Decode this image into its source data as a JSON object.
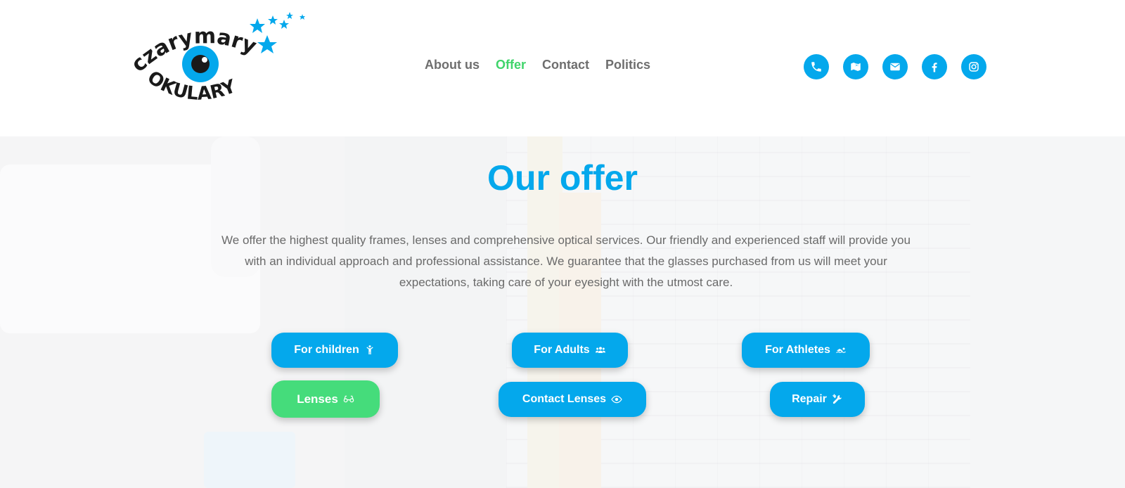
{
  "header": {
    "logo": {
      "text_top": "czarymary",
      "text_bottom": "OKULARY"
    },
    "nav": [
      {
        "label": "About us",
        "active": false
      },
      {
        "label": "Offer",
        "active": true
      },
      {
        "label": "Contact",
        "active": false
      },
      {
        "label": "Politics",
        "active": false
      }
    ],
    "socials": [
      {
        "icon": "phone-icon"
      },
      {
        "icon": "map-icon"
      },
      {
        "icon": "envelope-icon"
      },
      {
        "icon": "facebook-icon"
      },
      {
        "icon": "instagram-icon"
      }
    ]
  },
  "hero": {
    "title": "Our offer",
    "description": "We offer the highest quality frames, lenses and comprehensive optical services. Our friendly and experienced staff will provide you with an individual approach and professional assistance. We guarantee that the glasses purchased from us will meet your expectations, taking care of your eyesight with the utmost care.",
    "buttons": [
      {
        "label": "For children",
        "icon": "child-icon"
      },
      {
        "label": "For Adults",
        "icon": "users-icon"
      },
      {
        "label": "For Athletes",
        "icon": "swimmer-icon"
      },
      {
        "label": "Lenses",
        "icon": "glasses-icon"
      },
      {
        "label": "Contact Lenses",
        "icon": "eye-icon"
      },
      {
        "label": "Repair",
        "icon": "tools-icon"
      }
    ]
  },
  "colors": {
    "primary_blue": "#04a8ec",
    "active_green": "#3fd46a",
    "button_green": "#45dc7b",
    "nav_gray": "#6e6e6e"
  }
}
